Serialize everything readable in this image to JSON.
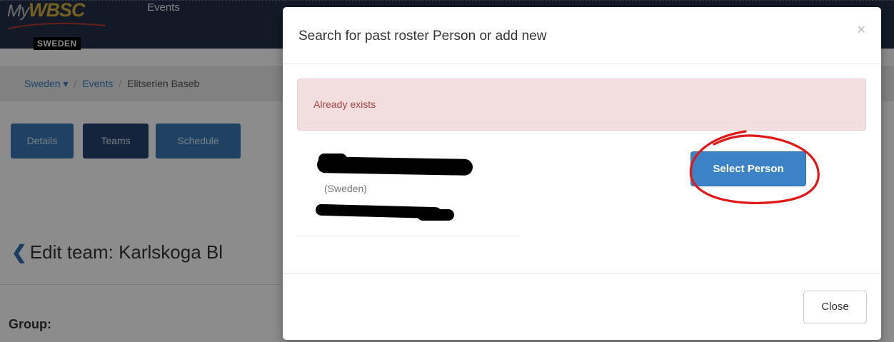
{
  "app": {
    "logo_prefix": "My",
    "logo_main": "WBSC",
    "country_badge": "SWEDEN",
    "nav_events": "Events"
  },
  "breadcrumb": {
    "country": "Sweden ▾",
    "events": "Events",
    "current": "Elitserien Baseb"
  },
  "tabs": [
    {
      "label": "Details",
      "active": false
    },
    {
      "label": "Teams",
      "active": true
    },
    {
      "label": "Schedule",
      "active": false
    }
  ],
  "page": {
    "title": "Edit team: Karlskoga Bl",
    "group_label": "Group:"
  },
  "modal": {
    "title": "Search for past roster Person or add new",
    "close_symbol": "×",
    "alert": "Already exists",
    "person": {
      "country": "(Sweden)"
    },
    "select_button": "Select Person",
    "close_button": "Close"
  },
  "colors": {
    "topbar": "#21304a",
    "primary": "#3b82c6",
    "alert_bg": "#f2dede",
    "alert_text": "#a94442",
    "annotation": "#e01818"
  }
}
